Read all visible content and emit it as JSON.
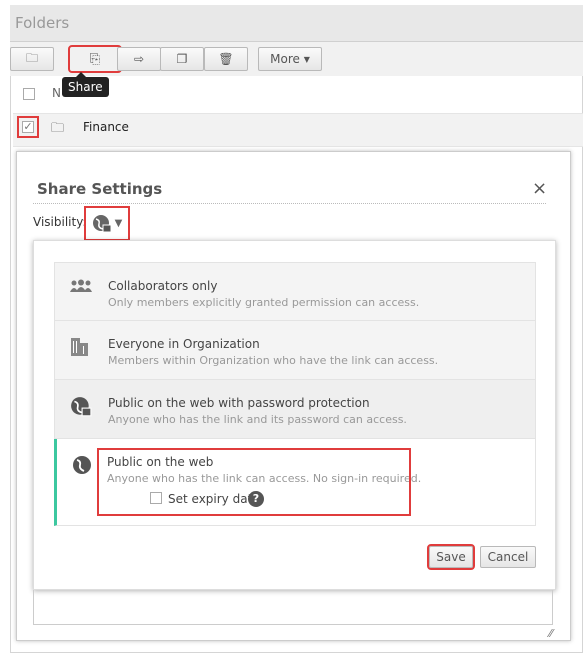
{
  "header": {
    "title": "Folders"
  },
  "toolbar": {
    "share_tooltip": "Share",
    "more_label": "More"
  },
  "list": {
    "header_label": "N",
    "rows": [
      {
        "name": "Finance",
        "checked": true
      }
    ]
  },
  "dialog": {
    "title": "Share Settings",
    "close": "×",
    "visibility_label": "Visibility:",
    "selected_visibility": "public-web-password-icon",
    "options": [
      {
        "title": "Collaborators only",
        "desc": "Only members explicitly granted permission can access.",
        "icon": "users-icon"
      },
      {
        "title": "Everyone in Organization",
        "desc": "Members within Organization who have the link can access.",
        "icon": "building-icon"
      },
      {
        "title": "Public on the web with password protection",
        "desc": "Anyone who has the link and its password can access.",
        "icon": "globe-lock-icon"
      },
      {
        "title": "Public on the web",
        "desc": "Anyone who has the link can access. No sign-in required.",
        "icon": "globe-icon",
        "selected": true
      }
    ],
    "expiry_label": "Set expiry date",
    "expiry_checked": false,
    "help": "?",
    "save": "Save",
    "cancel": "Cancel"
  },
  "colors": {
    "highlight": "#e03c3c",
    "selected_bar": "#3cc8a0"
  }
}
